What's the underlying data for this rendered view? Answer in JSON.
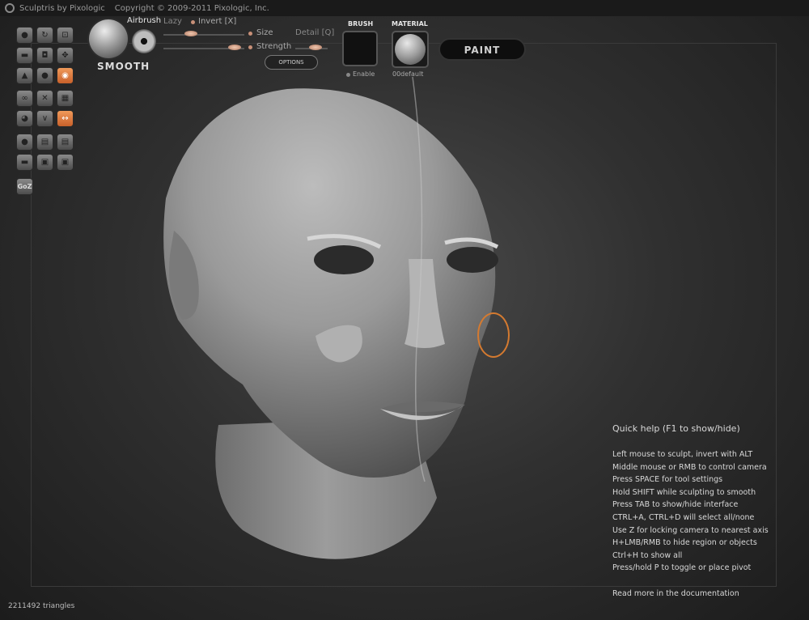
{
  "titlebar": {
    "app_title": "Sculptris by Pixologic",
    "copyright": "Copyright © 2009-2011 Pixologic, Inc."
  },
  "toolbar": {
    "brush_name": "SMOOTH",
    "airbrush": "Airbrush",
    "lazy": "Lazy",
    "invert": "Invert [X]",
    "size": "Size",
    "strength": "Strength",
    "detail": "Detail [Q]",
    "options": "OPTIONS",
    "brush_label": "BRUSH",
    "material_label": "MATERIAL",
    "enable": "Enable",
    "material_name": "00default",
    "paint": "PAINT"
  },
  "tools": {
    "group1": [
      "draw-icon",
      "rotate-icon",
      "crop-icon",
      "flatten-icon",
      "smooth-icon",
      "move-icon",
      "pinch-icon",
      "inflate-icon",
      "grab-icon"
    ],
    "group2": [
      "symmetry-icon",
      "wireframe-icon",
      "grid-icon",
      "crease-icon",
      "reduce-icon",
      "subdivide-icon"
    ],
    "group3": [
      "new-sphere-icon",
      "import-obj-icon",
      "export-obj-icon",
      "new-plane-icon",
      "save-icon",
      "open-icon"
    ],
    "goz": "GoZ",
    "active_tool": "grab-icon",
    "active_option": "subdivide-icon"
  },
  "quickhelp": {
    "title": "Quick help (F1 to show/hide)",
    "lines": [
      "Left mouse to sculpt, invert with ALT",
      "Middle mouse or RMB to control camera",
      "Press SPACE for tool settings",
      "Hold SHIFT while sculpting to smooth",
      "Press TAB to show/hide interface",
      "CTRL+A, CTRL+D will select all/none",
      "Use Z for locking camera to nearest axis",
      "H+LMB/RMB to hide region or objects",
      "Ctrl+H to show all",
      "Press/hold P to toggle or place pivot"
    ],
    "more": "Read more in the documentation"
  },
  "status": {
    "triangles": "2211492 triangles"
  },
  "colors": {
    "accent": "#d47a30",
    "background": "#2e2e2e"
  }
}
